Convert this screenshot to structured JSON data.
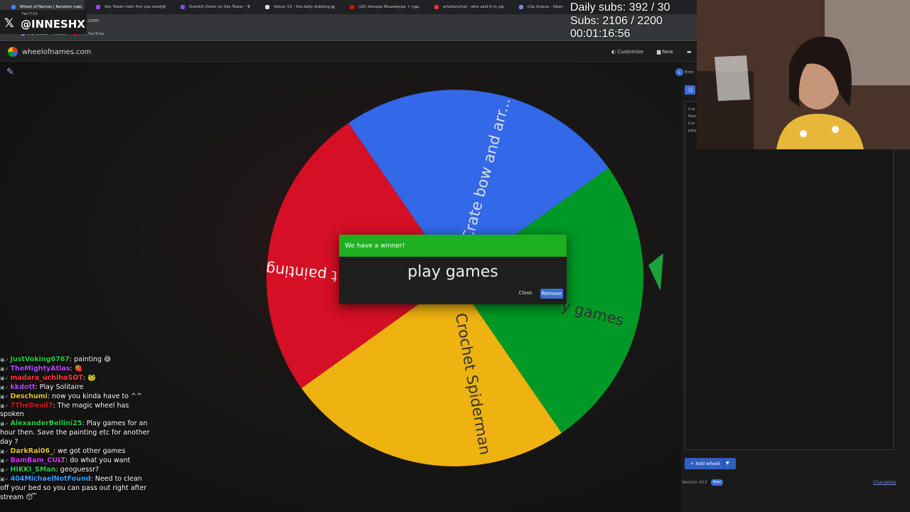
{
  "browser": {
    "tabs": [
      {
        "title": "Wheel of Names | Random nam",
        "active": true,
        "favicon_color": "#4285f4"
      },
      {
        "title": "Sky Tower ride! Are you ready?",
        "active": false,
        "favicon_color": "#9147ff"
      },
      {
        "title": "Overkill Zoom on Sky Tower - T",
        "active": false,
        "favicon_color": "#9147ff"
      },
      {
        "title": "Voicer 13 - the daily dubbing g",
        "active": false,
        "favicon_color": "#dddddd"
      },
      {
        "title": "(20) Хинари Йошимура. I тур",
        "active": false,
        "favicon_color": "#ff0000"
      },
      {
        "title": "whodunchat - who said it in yo",
        "active": false,
        "favicon_color": "#e33"
      },
      {
        "title": "Clip Queue - Open",
        "active": false,
        "favicon_color": "#7289da"
      }
    ],
    "address_suffix": ".com",
    "bookmarks": [
      {
        "label": "Clip Queue - Closed",
        "color": "#7289da"
      },
      {
        "label": "(47) YouTube",
        "color": "#ff0000"
      }
    ]
  },
  "twitter_overlay": {
    "label": "TWITTER",
    "handle": "@INNESHX",
    "icon": "x-logo-icon"
  },
  "stream_stats": {
    "daily_subs": "Daily subs: 392 / 30",
    "subs": "Subs: 2106 / 2200",
    "timer": "00:01:16:56"
  },
  "app": {
    "site_name": "wheelofnames.com",
    "customize_label": "Customize",
    "new_label": "New"
  },
  "wheel": {
    "segments": [
      {
        "label": "Crate bow and arr...",
        "color": "#3369e8"
      },
      {
        "label": "play games",
        "color": "#009925"
      },
      {
        "label": "Crochet Spiderman",
        "color": "#eeb211"
      },
      {
        "label": "painting",
        "color": "#d50f25"
      }
    ],
    "visible_segment_text": [
      "Crate bow and arr...",
      "y games",
      "Crochet Spiderman",
      "t painting"
    ]
  },
  "dialog": {
    "header": "We have a winner!",
    "winner": "play games",
    "close_label": "Close",
    "remove_label": "Remove",
    "header_color": "#1db020",
    "remove_color": "#3b6fd6"
  },
  "sidebar": {
    "entries_tab_label": "Entri",
    "entries_preview": [
      "Cra",
      "Pain",
      "Cro",
      "play"
    ],
    "add_wheel_label": "Add wheel",
    "version_label": "Version 423",
    "new_badge": "New!",
    "changelog_label": "Changelog"
  },
  "chat": [
    {
      "name": "JustVoking6767",
      "color": "#2ecc40",
      "msg": ": painting 😅"
    },
    {
      "name": "TheMightyAtlas",
      "color": "#b14bff",
      "msg": ": 🍓"
    },
    {
      "name": "madara_uchihaSOT",
      "color": "#ff3b3b",
      "msg": ": 🐸"
    },
    {
      "name": "kkdott",
      "color": "#b14bff",
      "msg": ": Play Solitaire"
    },
    {
      "name": "Deschumi",
      "color": "#e0c23b",
      "msg": ": now you kinda have to ^^"
    },
    {
      "name": "7TheDevil7",
      "color": "#e0151b",
      "msg": ": The magic wheel has spoken"
    },
    {
      "name": "AlexanderBellini25",
      "color": "#2ecc40",
      "msg": ": Play games for an hour then. Save the painting etc for another day ?"
    },
    {
      "name": "DarkRai06_",
      "color": "#e0c23b",
      "msg": ": we got other games"
    },
    {
      "name": "BamBam_CULT",
      "color": "#d633ff",
      "msg": ": do what you want"
    },
    {
      "name": "HIKKI_SMan",
      "color": "#2ecc40",
      "msg": ": geoguessr?"
    },
    {
      "name": "404MichaelNotFound",
      "color": "#3aa0ff",
      "msg": ": Need to clean off your bed so you can pass out right after stream 😴"
    }
  ]
}
